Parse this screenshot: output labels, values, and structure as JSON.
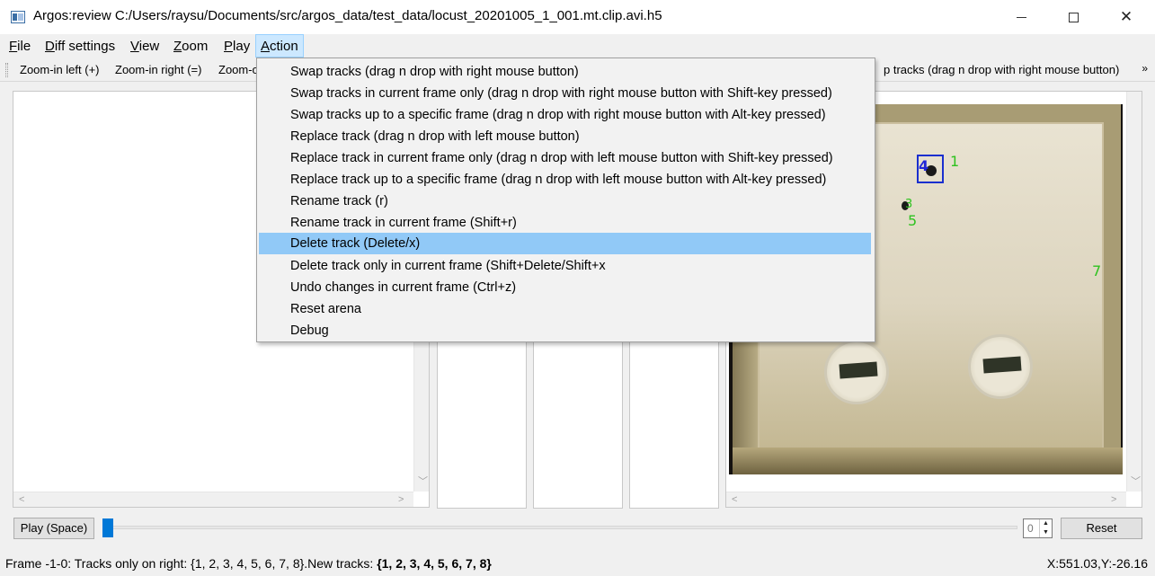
{
  "window": {
    "title": "Argos:review C:/Users/raysu/Documents/src/argos_data/test_data/locust_20201005_1_001.mt.clip.avi.h5",
    "minimize_glyph": "—",
    "maximize_glyph": "☐",
    "close_glyph": "✕"
  },
  "menubar": {
    "items": [
      {
        "label": "File"
      },
      {
        "label": "Diff settings"
      },
      {
        "label": "View"
      },
      {
        "label": "Zoom"
      },
      {
        "label": "Play"
      },
      {
        "label": "Action"
      }
    ],
    "active": "Action"
  },
  "toolbar": {
    "zoom_in_left": "Zoom-in left (+)",
    "zoom_in_right": "Zoom-in right (=)",
    "zoom_partial": "Zoom-o",
    "swap_partial": "p tracks (drag n drop with right mouse button)",
    "more": "»"
  },
  "action_menu": {
    "items": [
      {
        "label": "Swap tracks (drag n drop with right mouse button)"
      },
      {
        "label": "Swap tracks in current frame only (drag n drop with right mouse button with Shift-key pressed)"
      },
      {
        "label": "Swap tracks up to a specific frame (drag n drop with right mouse button with Alt-key pressed)"
      },
      {
        "label": "Replace track (drag n drop with left mouse button)"
      },
      {
        "label": "Replace track in current frame only (drag n drop with left mouse button with Shift-key pressed)"
      },
      {
        "label": "Replace track up to a specific frame (drag n drop with left mouse button with Alt-key pressed)"
      },
      {
        "label": "Rename track (r)"
      },
      {
        "label": "Rename track in current frame (Shift+r)"
      },
      {
        "label": "Delete track (Delete/x)"
      },
      {
        "label": "Delete track only in current frame (Shift+Delete/Shift+x"
      },
      {
        "label": "Undo changes in current frame (Ctrl+z)"
      },
      {
        "label": "Reset arena"
      },
      {
        "label": "Debug"
      }
    ],
    "highlighted_index": 8
  },
  "arena_labels": {
    "track_4": "4",
    "track_1": "1",
    "track_3": "3",
    "track_5": "5",
    "track_7": "7"
  },
  "colors": {
    "selection_box": "#1a2fcf",
    "track_label": "#2ec21f",
    "menu_highlight": "#91c9f7",
    "slider_handle": "#0078d7"
  },
  "controls": {
    "play_button": "Play (Space)",
    "reset_button": "Reset",
    "frame_spin_value": "0",
    "slider_position_fraction": 0.0
  },
  "statusbar": {
    "left_prefix": "Frame -1-0: Tracks only on right: {1, 2, 3, 4, 5, 6, 7, 8}.New tracks: ",
    "left_bold": "{1, 2, 3, 4, 5, 6, 7, 8}",
    "right": "X:551.03,Y:-26.16"
  }
}
